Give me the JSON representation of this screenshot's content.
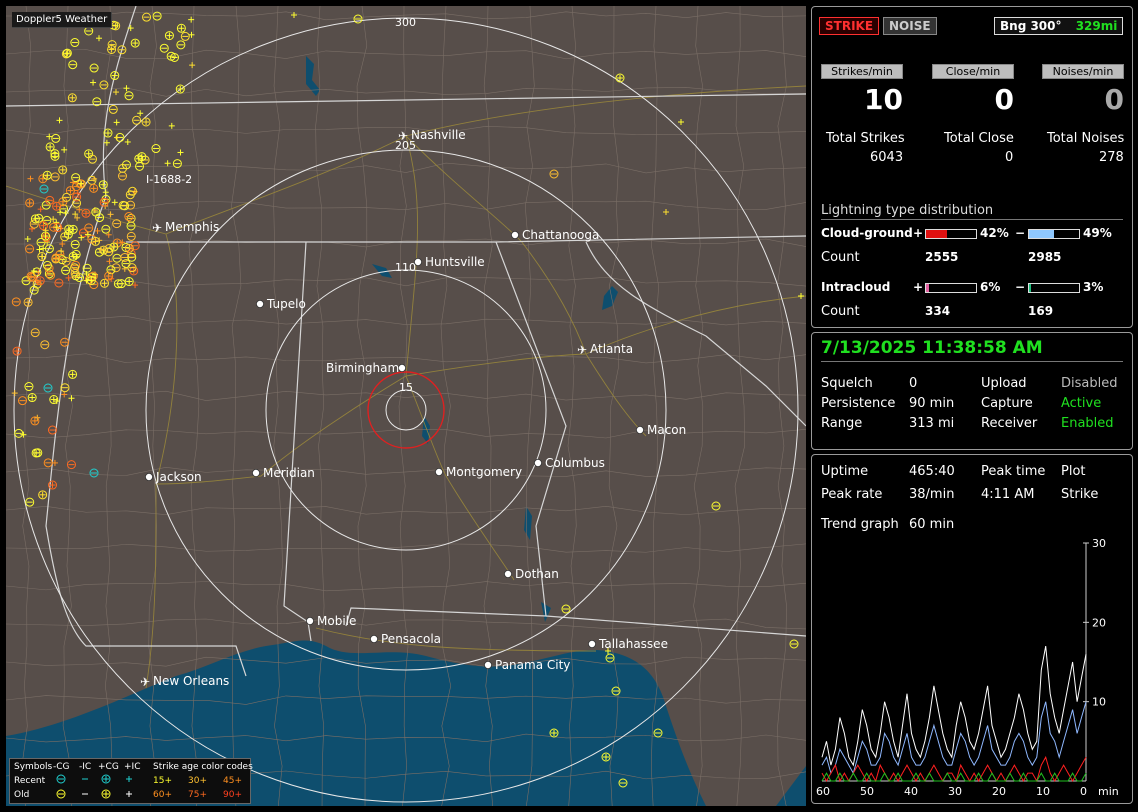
{
  "map": {
    "tag": "Doppler5 Weather",
    "ring_labels": [
      "15",
      "110",
      "205",
      "300"
    ],
    "route_label": "I-1688-2",
    "cities": [
      {
        "name": "Nashville",
        "type": "airport"
      },
      {
        "name": "Memphis",
        "type": "airport"
      },
      {
        "name": "Chattanooga",
        "type": "city"
      },
      {
        "name": "Huntsville",
        "type": "city"
      },
      {
        "name": "Tupelo",
        "type": "city"
      },
      {
        "name": "Atlanta",
        "type": "airport"
      },
      {
        "name": "Birmingham",
        "type": "city"
      },
      {
        "name": "Macon",
        "type": "city"
      },
      {
        "name": "Jackson",
        "type": "city"
      },
      {
        "name": "Meridian",
        "type": "city"
      },
      {
        "name": "Montgomery",
        "type": "city"
      },
      {
        "name": "Columbus",
        "type": "city"
      },
      {
        "name": "Dothan",
        "type": "city"
      },
      {
        "name": "Mobile",
        "type": "city"
      },
      {
        "name": "Pensacola",
        "type": "city"
      },
      {
        "name": "Tallahassee",
        "type": "city"
      },
      {
        "name": "Panama City",
        "type": "city"
      },
      {
        "name": "New Orleans",
        "type": "airport"
      }
    ],
    "colors": {
      "land": "#574e4a",
      "water": "#0e4e6e",
      "border": "#d6d6d6",
      "county": "#7a6e66",
      "roads": "#9c8a3a",
      "ring": "#e8e8e8",
      "center_ring": "#e02020",
      "recent": "#ffff30",
      "old": "#ff9020"
    }
  },
  "legend": {
    "symbols_label": "Symbols",
    "col_headers": [
      "-CG",
      "-IC",
      "+CG",
      "+IC"
    ],
    "recent_label": "Recent",
    "old_label": "Old",
    "age_title": "Strike age color codes",
    "recent_ages": [
      "15+",
      "30+",
      "45+"
    ],
    "old_ages": [
      "60+",
      "75+",
      "90+"
    ]
  },
  "top": {
    "strike_btn": "STRIKE",
    "noise_btn": "NOISE",
    "bearing": "Bng 300°",
    "range": "329mi",
    "rate_headers": [
      "Strikes/min",
      "Close/min",
      "Noises/min"
    ],
    "rate_values": [
      "10",
      "0",
      "0"
    ],
    "total_labels": [
      "Total Strikes",
      "Total Close",
      "Total Noises"
    ],
    "total_values": [
      "6043",
      "0",
      "278"
    ],
    "dist_title": "Lightning type distribution",
    "cg_label": "Cloud-ground",
    "ic_label": "Intracloud",
    "count_label": "Count",
    "cg_pos_pct": "42%",
    "cg_neg_pct": "49%",
    "ic_pos_pct": "6%",
    "ic_neg_pct": "3%",
    "cg_pos_frac": 0.42,
    "cg_neg_frac": 0.49,
    "ic_pos_frac": 0.06,
    "ic_neg_frac": 0.03,
    "cg_pos_count": "2555",
    "cg_neg_count": "2985",
    "ic_pos_count": "334",
    "ic_neg_count": "169",
    "plus": "+",
    "minus": "−"
  },
  "status": {
    "datetime": "7/13/2025 11:38:58 AM",
    "squelch_label": "Squelch",
    "squelch": "0",
    "persistence_label": "Persistence",
    "persistence": "90 min",
    "range_label": "Range",
    "range": "313 mi",
    "upload_label": "Upload",
    "upload": "Disabled",
    "capture_label": "Capture",
    "capture": "Active",
    "receiver_label": "Receiver",
    "receiver": "Enabled"
  },
  "trend": {
    "uptime_label": "Uptime",
    "uptime": "465:40",
    "peak_time_label": "Peak time",
    "peak_time": "4:11 AM",
    "plot_label": "Plot",
    "plot": "Strike",
    "peak_rate_label": "Peak rate",
    "peak_rate": "38/min",
    "trend_label": "Trend graph",
    "trend": "60 min"
  },
  "chart_data": {
    "type": "line",
    "xlabel": "min",
    "x_ticks": [
      "60",
      "50",
      "40",
      "30",
      "20",
      "10",
      "0"
    ],
    "y_ticks": [
      "30",
      "20",
      "10"
    ],
    "ylim": [
      0,
      30
    ],
    "xlim": [
      60,
      0
    ],
    "series": [
      {
        "color": "#ffffff",
        "values": [
          3,
          5,
          2,
          4,
          8,
          6,
          3,
          2,
          5,
          9,
          7,
          4,
          3,
          6,
          10,
          8,
          5,
          3,
          7,
          11,
          6,
          4,
          3,
          5,
          8,
          12,
          9,
          6,
          4,
          3,
          7,
          10,
          8,
          5,
          4,
          6,
          9,
          12,
          7,
          5,
          3,
          4,
          6,
          8,
          11,
          9,
          6,
          4,
          5,
          14,
          17,
          11,
          8,
          6,
          9,
          12,
          15,
          10,
          13,
          16
        ]
      },
      {
        "color": "#8fb8ff",
        "values": [
          2,
          3,
          1,
          2,
          4,
          3,
          2,
          1,
          3,
          5,
          4,
          2,
          2,
          3,
          6,
          5,
          3,
          2,
          4,
          6,
          3,
          2,
          2,
          3,
          5,
          7,
          5,
          3,
          2,
          2,
          4,
          6,
          5,
          3,
          2,
          3,
          5,
          7,
          4,
          3,
          2,
          2,
          3,
          5,
          6,
          5,
          3,
          2,
          3,
          8,
          10,
          6,
          5,
          3,
          5,
          7,
          9,
          6,
          8,
          10
        ]
      },
      {
        "color": "#ff2020",
        "values": [
          1,
          0,
          1,
          2,
          0,
          1,
          0,
          1,
          2,
          1,
          0,
          1,
          0,
          2,
          1,
          0,
          1,
          0,
          1,
          2,
          1,
          0,
          1,
          0,
          1,
          2,
          1,
          0,
          1,
          1,
          0,
          2,
          1,
          0,
          1,
          0,
          1,
          2,
          1,
          0,
          1,
          0,
          1,
          2,
          1,
          0,
          1,
          1,
          0,
          2,
          3,
          1,
          0,
          1,
          2,
          1,
          0,
          1,
          2,
          3
        ]
      },
      {
        "color": "#20c020",
        "values": [
          0,
          1,
          0,
          0,
          1,
          0,
          0,
          1,
          0,
          0,
          1,
          0,
          0,
          0,
          1,
          0,
          0,
          1,
          0,
          0,
          0,
          1,
          0,
          0,
          1,
          0,
          0,
          0,
          1,
          0,
          0,
          1,
          0,
          0,
          0,
          1,
          0,
          0,
          1,
          0,
          0,
          0,
          1,
          0,
          0,
          1,
          0,
          0,
          0,
          1,
          0,
          0,
          1,
          0,
          0,
          0,
          1,
          0,
          0,
          1
        ]
      }
    ]
  }
}
